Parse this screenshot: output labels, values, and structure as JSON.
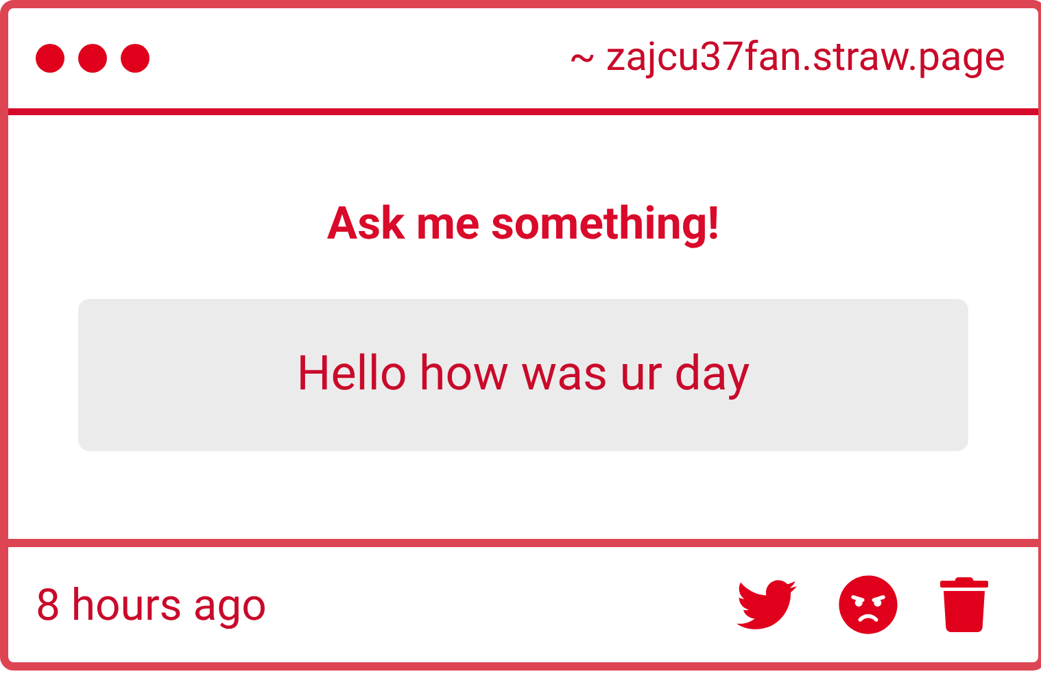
{
  "header": {
    "url": "~ zajcu37fan.straw.page"
  },
  "card": {
    "title": "Ask me something!",
    "question": "Hello how was ur day"
  },
  "footer": {
    "time": "8 hours ago"
  }
}
